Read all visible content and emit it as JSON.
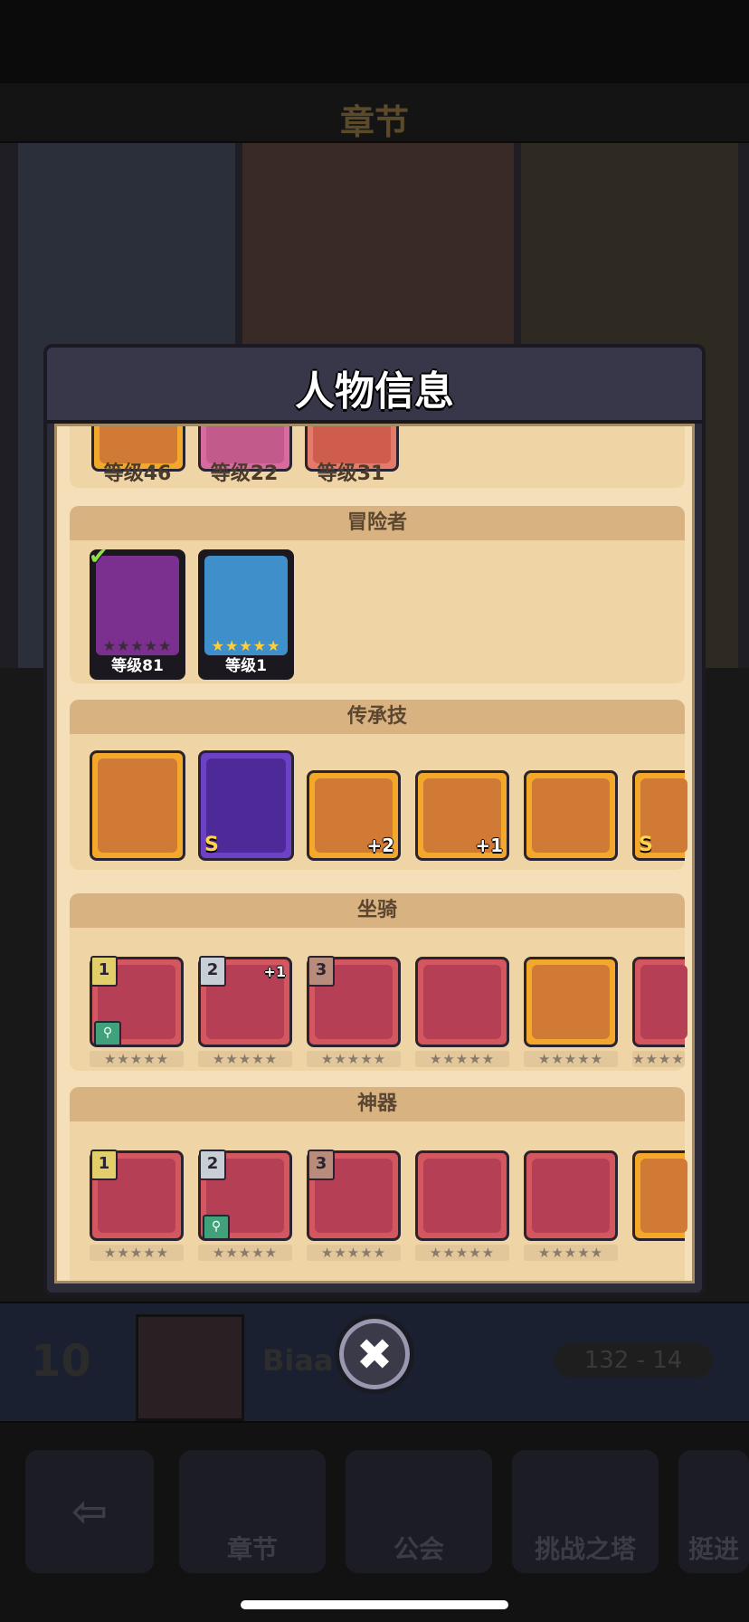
{
  "background": {
    "chapter_title": "章节",
    "player_level": "10",
    "player_name": "Biaa",
    "record": "132 - 14",
    "nav_items": [
      "章节",
      "公会",
      "挑战之塔",
      "挺进"
    ]
  },
  "modal": {
    "title": "人物信息",
    "top_levels": [
      "等级46",
      "等级22",
      "等级31"
    ],
    "adventurers": {
      "header": "冒险者",
      "items": [
        {
          "level": "等级81",
          "stars": "★★★★★"
        },
        {
          "level": "等级1",
          "stars": "★★★★★"
        }
      ]
    },
    "inherit_skills": {
      "header": "传承技",
      "items": [
        {
          "icon": "ghost-sombrero-icon",
          "badge": ""
        },
        {
          "icon": "armored-knight-icon",
          "badge": "S"
        },
        {
          "icon": "hooded-bear-icon",
          "badge": "+2"
        },
        {
          "icon": "bandit-icon",
          "badge": "+1"
        },
        {
          "icon": "blue-fish-icon",
          "badge": ""
        },
        {
          "icon": "rat-icon",
          "badge": "S"
        }
      ]
    },
    "mounts": {
      "header": "坐骑",
      "items": [
        {
          "icon": "sabertooth-tiger-icon",
          "rank": "1",
          "plus": ""
        },
        {
          "icon": "purple-dragon-icon",
          "rank": "2",
          "plus": "+1"
        },
        {
          "icon": "unicorn-icon",
          "rank": "3",
          "plus": ""
        },
        {
          "icon": "mummy-cat-icon",
          "rank": "",
          "plus": ""
        },
        {
          "icon": "cow-icon",
          "rank": "",
          "plus": ""
        },
        {
          "icon": "gorilla-icon",
          "rank": "",
          "plus": ""
        }
      ],
      "stars": "★★★★★"
    },
    "artifacts": {
      "header": "神器",
      "items": [
        {
          "icon": "lightning-staff-icon",
          "rank": "1"
        },
        {
          "icon": "ice-sword-icon",
          "rank": "2"
        },
        {
          "icon": "battle-axe-icon",
          "rank": "3"
        },
        {
          "icon": "winged-key-icon",
          "rank": ""
        },
        {
          "icon": "green-blade-icon",
          "rank": ""
        },
        {
          "icon": "star-wand-icon",
          "rank": ""
        }
      ],
      "stars": "★★★★★"
    },
    "close_label": "✖"
  }
}
